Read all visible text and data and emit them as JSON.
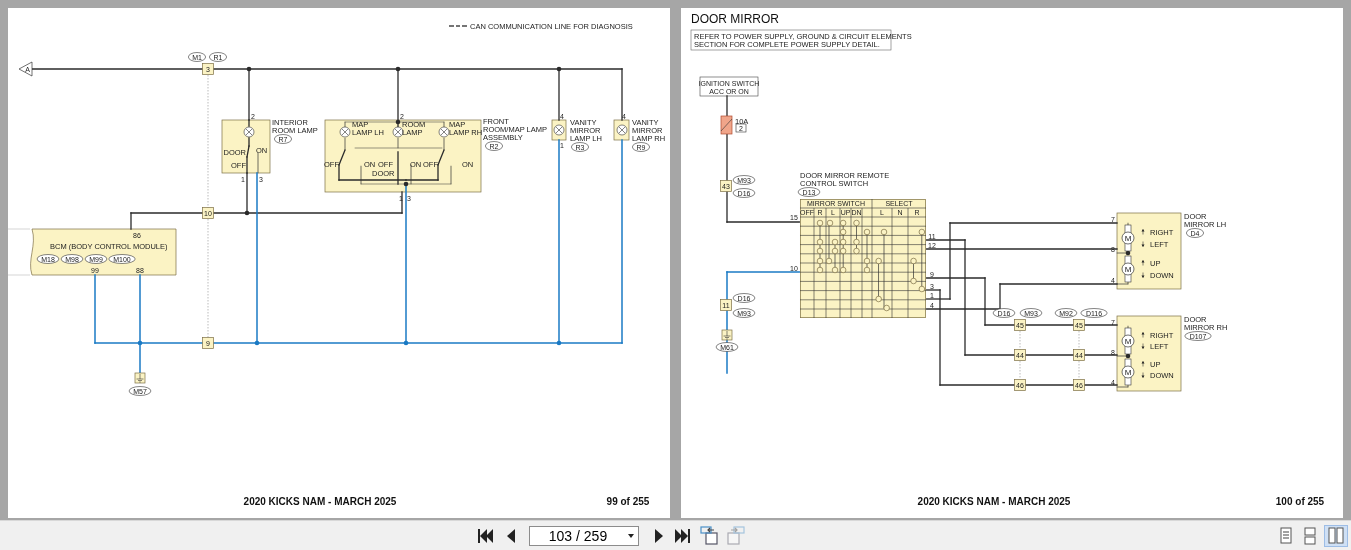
{
  "left_page": {
    "items": [
      {
        "kind": "legend",
        "text": "CAN COMMUNICATION LINE FOR DIAGNOSIS"
      },
      {
        "kind": "connector",
        "text": "M1"
      },
      {
        "kind": "connector",
        "text": "R1"
      },
      {
        "kind": "terminal",
        "text": "3"
      },
      {
        "kind": "pin",
        "text": "2"
      },
      {
        "kind": "label",
        "text": "INTERIOR"
      },
      {
        "kind": "label",
        "text": "ROOM LAMP"
      },
      {
        "kind": "connector",
        "text": "R7"
      },
      {
        "kind": "label",
        "text": "DOOR"
      },
      {
        "kind": "label",
        "text": "ON"
      },
      {
        "kind": "label",
        "text": "OFF"
      },
      {
        "kind": "pin",
        "text": "1"
      },
      {
        "kind": "pin",
        "text": "3"
      },
      {
        "kind": "pin",
        "text": "2"
      },
      {
        "kind": "label",
        "text": "MAP"
      },
      {
        "kind": "label",
        "text": "LAMP LH"
      },
      {
        "kind": "label",
        "text": "ROOM"
      },
      {
        "kind": "label",
        "text": "LAMP"
      },
      {
        "kind": "label",
        "text": "MAP"
      },
      {
        "kind": "label",
        "text": "LAMP RH"
      },
      {
        "kind": "label",
        "text": "FRONT"
      },
      {
        "kind": "label",
        "text": "ROOM/MAP LAMP"
      },
      {
        "kind": "label",
        "text": "ASSEMBLY"
      },
      {
        "kind": "connector",
        "text": "R2"
      },
      {
        "kind": "label",
        "text": "OFF"
      },
      {
        "kind": "label",
        "text": "ON"
      },
      {
        "kind": "label",
        "text": "OFF"
      },
      {
        "kind": "label",
        "text": "ON"
      },
      {
        "kind": "label",
        "text": "OFF"
      },
      {
        "kind": "label",
        "text": "ON"
      },
      {
        "kind": "label",
        "text": "DOOR"
      },
      {
        "kind": "pin",
        "text": "1"
      },
      {
        "kind": "pin",
        "text": "3"
      },
      {
        "kind": "pin",
        "text": "4"
      },
      {
        "kind": "label",
        "text": "VANITY"
      },
      {
        "kind": "label",
        "text": "MIRROR"
      },
      {
        "kind": "label",
        "text": "LAMP LH"
      },
      {
        "kind": "connector",
        "text": "R3"
      },
      {
        "kind": "pin",
        "text": "1"
      },
      {
        "kind": "pin",
        "text": "4"
      },
      {
        "kind": "label",
        "text": "VANITY"
      },
      {
        "kind": "label",
        "text": "MIRROR"
      },
      {
        "kind": "label",
        "text": "LAMP RH"
      },
      {
        "kind": "connector",
        "text": "R9"
      },
      {
        "kind": "terminal",
        "text": "10"
      },
      {
        "kind": "pin",
        "text": "86"
      },
      {
        "kind": "label",
        "text": "BCM (BODY CONTROL MODULE)"
      },
      {
        "kind": "connector",
        "text": "M18"
      },
      {
        "kind": "connector",
        "text": "M98"
      },
      {
        "kind": "connector",
        "text": "M99"
      },
      {
        "kind": "connector",
        "text": "M100"
      },
      {
        "kind": "pin",
        "text": "99"
      },
      {
        "kind": "pin",
        "text": "88"
      },
      {
        "kind": "terminal",
        "text": "9"
      },
      {
        "kind": "connector",
        "text": "M57"
      },
      {
        "kind": "offpage",
        "text": "A"
      }
    ],
    "footer": {
      "title": "2020 KICKS NAM - MARCH 2025",
      "page": "99 of 255"
    }
  },
  "right_page": {
    "title": "DOOR MIRROR",
    "items": [
      {
        "kind": "note",
        "text": "REFER TO POWER SUPPLY, GROUND & CIRCUIT ELEMENTS"
      },
      {
        "kind": "note",
        "text": "SECTION FOR COMPLETE POWER SUPPLY DETAIL."
      },
      {
        "kind": "boxline",
        "text": "IGNITION SWITCH"
      },
      {
        "kind": "boxline",
        "text": "ACC OR ON"
      },
      {
        "kind": "label",
        "text": "10A"
      },
      {
        "kind": "fuseno",
        "text": "2"
      },
      {
        "kind": "terminal",
        "text": "43"
      },
      {
        "kind": "connector",
        "text": "M93"
      },
      {
        "kind": "connector",
        "text": "D16"
      },
      {
        "kind": "label",
        "text": "DOOR MIRROR REMOTE"
      },
      {
        "kind": "label",
        "text": "CONTROL SWITCH"
      },
      {
        "kind": "connector",
        "text": "D13"
      },
      {
        "kind": "header",
        "text": "MIRROR SWITCH"
      },
      {
        "kind": "header",
        "text": "SELECT"
      },
      {
        "kind": "subhead",
        "text": "OFF"
      },
      {
        "kind": "subhead",
        "text": "R"
      },
      {
        "kind": "subhead",
        "text": "L"
      },
      {
        "kind": "subhead",
        "text": "UP"
      },
      {
        "kind": "subhead",
        "text": "DN"
      },
      {
        "kind": "subhead",
        "text": "L"
      },
      {
        "kind": "subhead",
        "text": "N"
      },
      {
        "kind": "subhead",
        "text": "R"
      },
      {
        "kind": "pin",
        "text": "15"
      },
      {
        "kind": "pin",
        "text": "10"
      },
      {
        "kind": "pin",
        "text": "11"
      },
      {
        "kind": "pin",
        "text": "12"
      },
      {
        "kind": "pin",
        "text": "9"
      },
      {
        "kind": "pin",
        "text": "3"
      },
      {
        "kind": "pin",
        "text": "1"
      },
      {
        "kind": "pin",
        "text": "4"
      },
      {
        "kind": "terminal",
        "text": "11"
      },
      {
        "kind": "connector",
        "text": "D16"
      },
      {
        "kind": "connector",
        "text": "M93"
      },
      {
        "kind": "connector",
        "text": "M61"
      },
      {
        "kind": "pin",
        "text": "7"
      },
      {
        "kind": "pin",
        "text": "8"
      },
      {
        "kind": "pin",
        "text": "4"
      },
      {
        "kind": "label",
        "text": "RIGHT"
      },
      {
        "kind": "label",
        "text": "LEFT"
      },
      {
        "kind": "label",
        "text": "UP"
      },
      {
        "kind": "label",
        "text": "DOWN"
      },
      {
        "kind": "label",
        "text": "DOOR"
      },
      {
        "kind": "label",
        "text": "MIRROR LH"
      },
      {
        "kind": "connector",
        "text": "D4"
      },
      {
        "kind": "connector",
        "text": "D16"
      },
      {
        "kind": "connector",
        "text": "M93"
      },
      {
        "kind": "connector",
        "text": "M92"
      },
      {
        "kind": "connector",
        "text": "D116"
      },
      {
        "kind": "terminal",
        "text": "45"
      },
      {
        "kind": "terminal",
        "text": "45"
      },
      {
        "kind": "terminal",
        "text": "44"
      },
      {
        "kind": "terminal",
        "text": "44"
      },
      {
        "kind": "terminal",
        "text": "46"
      },
      {
        "kind": "terminal",
        "text": "46"
      },
      {
        "kind": "pin",
        "text": "7"
      },
      {
        "kind": "pin",
        "text": "8"
      },
      {
        "kind": "pin",
        "text": "4"
      },
      {
        "kind": "label",
        "text": "RIGHT"
      },
      {
        "kind": "label",
        "text": "LEFT"
      },
      {
        "kind": "label",
        "text": "UP"
      },
      {
        "kind": "label",
        "text": "DOWN"
      },
      {
        "kind": "label",
        "text": "DOOR"
      },
      {
        "kind": "label",
        "text": "MIRROR RH"
      },
      {
        "kind": "connector",
        "text": "D107"
      },
      {
        "kind": "motor",
        "text": "M"
      },
      {
        "kind": "motor",
        "text": "M"
      },
      {
        "kind": "motor",
        "text": "M"
      },
      {
        "kind": "motor",
        "text": "M"
      }
    ],
    "footer": {
      "title": "2020 KICKS NAM - MARCH 2025",
      "page": "100 of 255"
    }
  },
  "toolbar": {
    "nav": [
      {
        "kind": "first"
      },
      {
        "kind": "prev"
      },
      {
        "kind": "field",
        "value": "103 / 259"
      },
      {
        "kind": "next"
      },
      {
        "kind": "last"
      }
    ],
    "tools": [
      {
        "kind": "back",
        "disabled": false
      },
      {
        "kind": "forward",
        "disabled": true
      }
    ],
    "views": [
      {
        "kind": "single",
        "selected": false
      },
      {
        "kind": "continuous",
        "selected": false
      },
      {
        "kind": "two_page",
        "selected": true
      }
    ]
  }
}
